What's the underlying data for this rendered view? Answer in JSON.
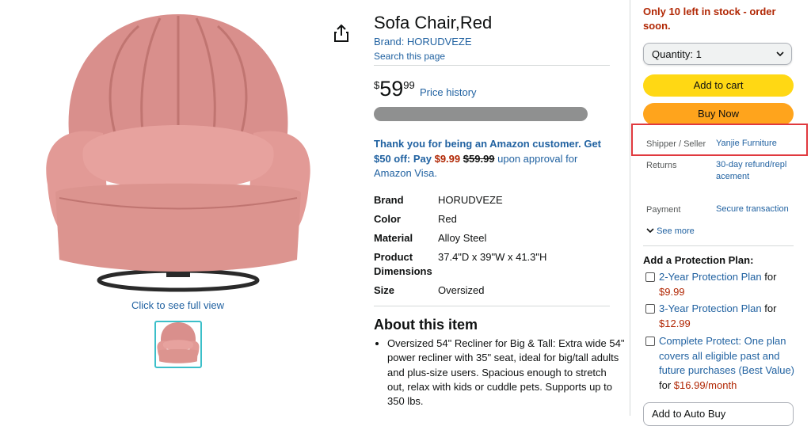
{
  "product": {
    "title": "Sofa Chair,Red",
    "brand_link": "Brand: HORUDVEZE",
    "search_page": "Search this page",
    "full_view": "Click to see full view"
  },
  "price": {
    "symbol": "$",
    "whole": "59",
    "fraction": "99",
    "history": "Price history"
  },
  "promo": {
    "text1": "Thank you for being an Amazon customer. Get $50 off: Pay ",
    "pay_price": "$9.99",
    "orig_price": "$59.99",
    "text2": " upon approval for Amazon Visa."
  },
  "specs": [
    {
      "key": "Brand",
      "value": "HORUDVEZE"
    },
    {
      "key": "Color",
      "value": "Red"
    },
    {
      "key": "Material",
      "value": "Alloy Steel"
    },
    {
      "key": "Product Dimensions",
      "value": "37.4\"D x 39\"W x 41.3\"H"
    },
    {
      "key": "Size",
      "value": "Oversized"
    }
  ],
  "about": {
    "title": "About this item",
    "bullets": [
      "Oversized 54\" Recliner for Big & Tall: Extra wide 54\" power recliner with 35\" seat, ideal for big/tall adults and plus-size users. Spacious enough to stretch out, relax with kids or cuddle pets. Supports up to 350 lbs."
    ]
  },
  "buybox": {
    "stock": "Only 10 left in stock - order soon.",
    "quantity_label": "Quantity:",
    "quantity_value": "1",
    "add_to_cart": "Add to cart",
    "buy_now": "Buy Now",
    "shipper_label": "Shipper / Seller",
    "shipper_value": "Yanjie Furniture",
    "returns_label": "Returns",
    "returns_value": "30-day refund/replacement",
    "payment_label": "Payment",
    "payment_value": "Secure transaction",
    "see_more": "See more",
    "protection_title": "Add a Protection Plan:",
    "plans": [
      {
        "link": "2-Year Protection Plan",
        "for": " for ",
        "price": "$9.99",
        "suffix": ""
      },
      {
        "link": "3-Year Protection Plan",
        "for": " for ",
        "price": "$12.99",
        "suffix": ""
      },
      {
        "link": "Complete Protect: One plan covers all eligible past and future purchases (Best Value)",
        "for": " for ",
        "price": "$16.99/month",
        "suffix": ""
      }
    ],
    "auto_buy": "Add to Auto Buy"
  },
  "colors": {
    "link": "#2162a1",
    "price_red": "#b12704",
    "add_to_cart": "#ffd814",
    "buy_now": "#ffa41c",
    "highlight": "#e0393e"
  }
}
